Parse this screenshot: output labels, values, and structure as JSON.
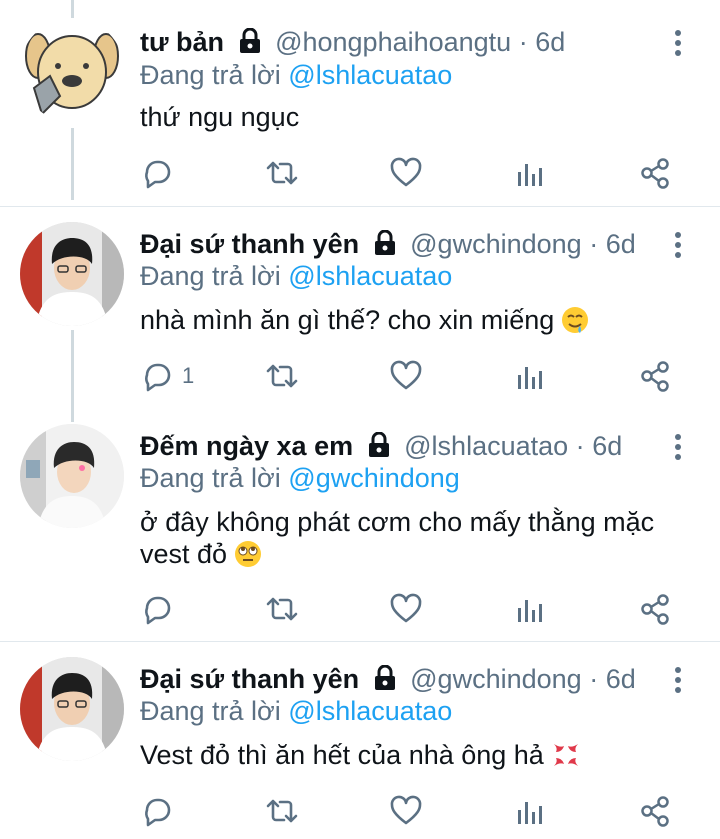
{
  "tweets": [
    {
      "name": "tư bản",
      "handle": "@hongphaihoangtu",
      "dot": "·",
      "time": "6d",
      "reply_prefix": "Đang trả lời",
      "reply_to": "@lshlacuatao",
      "text": "thứ ngu ngục",
      "emoji": "",
      "avatar": "dog-avatar",
      "reply_count": ""
    },
    {
      "name": "Đại sứ thanh yên",
      "handle": "@gwchindong",
      "dot": "·",
      "time": "6d",
      "reply_prefix": "Đang trả lời",
      "reply_to": "@lshlacuatao",
      "text": "nhà mình ăn gì thế? cho xin miếng",
      "emoji": "drooling-face",
      "avatar": "person-avatar",
      "reply_count": "1"
    },
    {
      "name": "Đếm ngày xa em",
      "handle": "@lshlacuatao",
      "dot": "·",
      "time": "6d",
      "reply_prefix": "Đang trả lời",
      "reply_to": "@gwchindong",
      "text_line1": "ở đây không phát cơm cho mấy thằng mặc",
      "text_line2": "vest đỏ",
      "emoji": "eye-roll-face",
      "avatar": "person-avatar",
      "reply_count": ""
    },
    {
      "name": "Đại sứ thanh yên",
      "handle": "@gwchindong",
      "dot": "·",
      "time": "6d",
      "reply_prefix": "Đang trả lời",
      "reply_to": "@lshlacuatao",
      "text": "Vest đỏ thì ăn hết của nhà ông hả",
      "emoji": "anger-symbol",
      "avatar": "person-avatar",
      "reply_count": ""
    }
  ],
  "icons": {
    "lock": "lock-icon",
    "more": "more-vertical-icon",
    "reply": "reply-icon",
    "retweet": "retweet-icon",
    "like": "heart-icon",
    "analytics": "analytics-icon",
    "share": "share-icon"
  },
  "colors": {
    "text": "#0f1419",
    "secondary": "#5b7083",
    "mention": "#1da1f2",
    "divider": "#e1e8ed"
  }
}
